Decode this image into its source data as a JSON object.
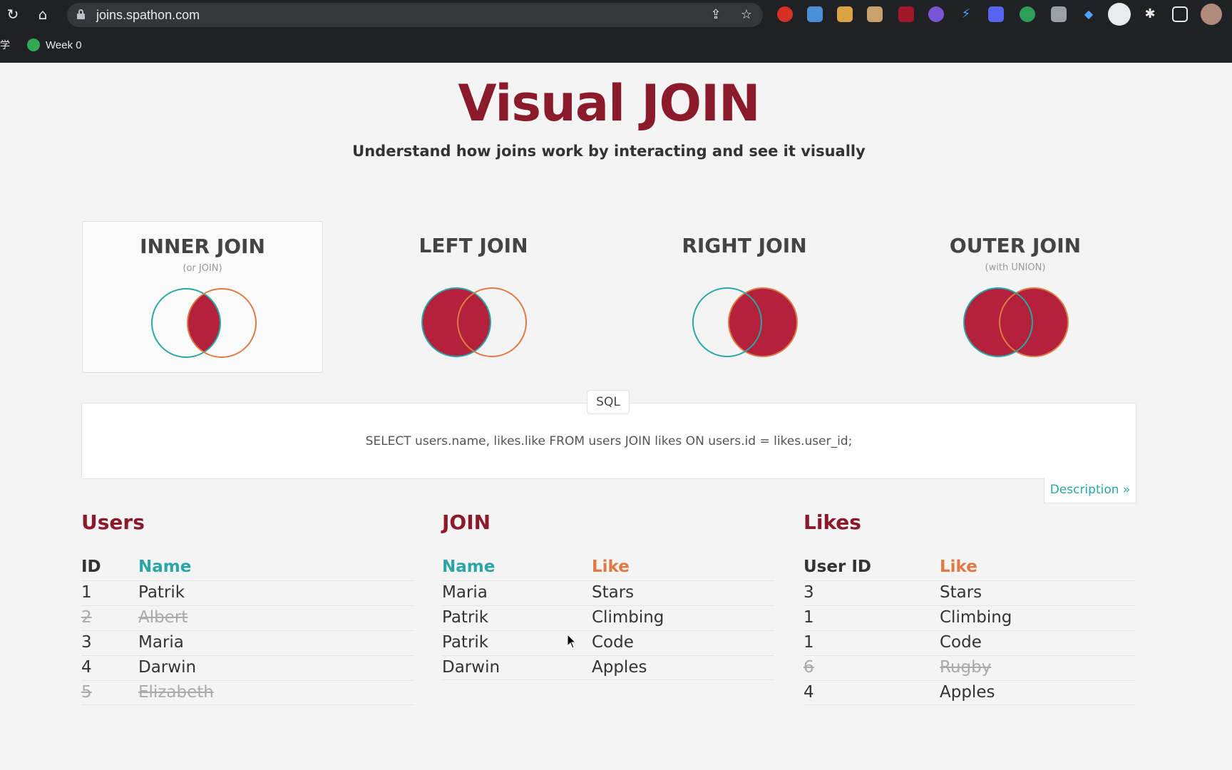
{
  "browser": {
    "url": "joins.spathon.com",
    "bookmark_prefix": "学",
    "bookmark": "Week 0"
  },
  "header": {
    "title": "Visual JOIN",
    "subtitle": "Understand how joins work by interacting and see it visually"
  },
  "joins": [
    {
      "title": "INNER JOIN",
      "subtitle": "(or JOIN)",
      "active": true
    },
    {
      "title": "LEFT JOIN",
      "subtitle": "",
      "active": false
    },
    {
      "title": "RIGHT JOIN",
      "subtitle": "",
      "active": false
    },
    {
      "title": "OUTER JOIN",
      "subtitle": "(with UNION)",
      "active": false
    }
  ],
  "sql": {
    "tab_label": "SQL",
    "query": "SELECT users.name, likes.like FROM users JOIN likes ON users.id = likes.user_id;",
    "description_link": "Description »"
  },
  "users": {
    "title": "Users",
    "headers": [
      "ID",
      "Name"
    ],
    "rows": [
      {
        "id": "1",
        "name": "Patrik",
        "excluded": false
      },
      {
        "id": "2",
        "name": "Albert",
        "excluded": true
      },
      {
        "id": "3",
        "name": "Maria",
        "excluded": false
      },
      {
        "id": "4",
        "name": "Darwin",
        "excluded": false
      },
      {
        "id": "5",
        "name": "Elizabeth",
        "excluded": true
      }
    ]
  },
  "join_result": {
    "title": "JOIN",
    "headers": [
      "Name",
      "Like"
    ],
    "rows": [
      {
        "name": "Maria",
        "like": "Stars"
      },
      {
        "name": "Patrik",
        "like": "Climbing"
      },
      {
        "name": "Patrik",
        "like": "Code"
      },
      {
        "name": "Darwin",
        "like": "Apples"
      }
    ]
  },
  "likes": {
    "title": "Likes",
    "headers": [
      "User ID",
      "Like"
    ],
    "rows": [
      {
        "user_id": "3",
        "like": "Stars",
        "excluded": false
      },
      {
        "user_id": "1",
        "like": "Climbing",
        "excluded": false
      },
      {
        "user_id": "1",
        "like": "Code",
        "excluded": false
      },
      {
        "user_id": "6",
        "like": "Rugby",
        "excluded": true
      },
      {
        "user_id": "4",
        "like": "Apples",
        "excluded": false
      }
    ]
  },
  "colors": {
    "brand": "#8b1a2b",
    "venn_fill": "#b3213a",
    "left_circle": "#2aa6a6",
    "right_circle": "#e07a45"
  }
}
